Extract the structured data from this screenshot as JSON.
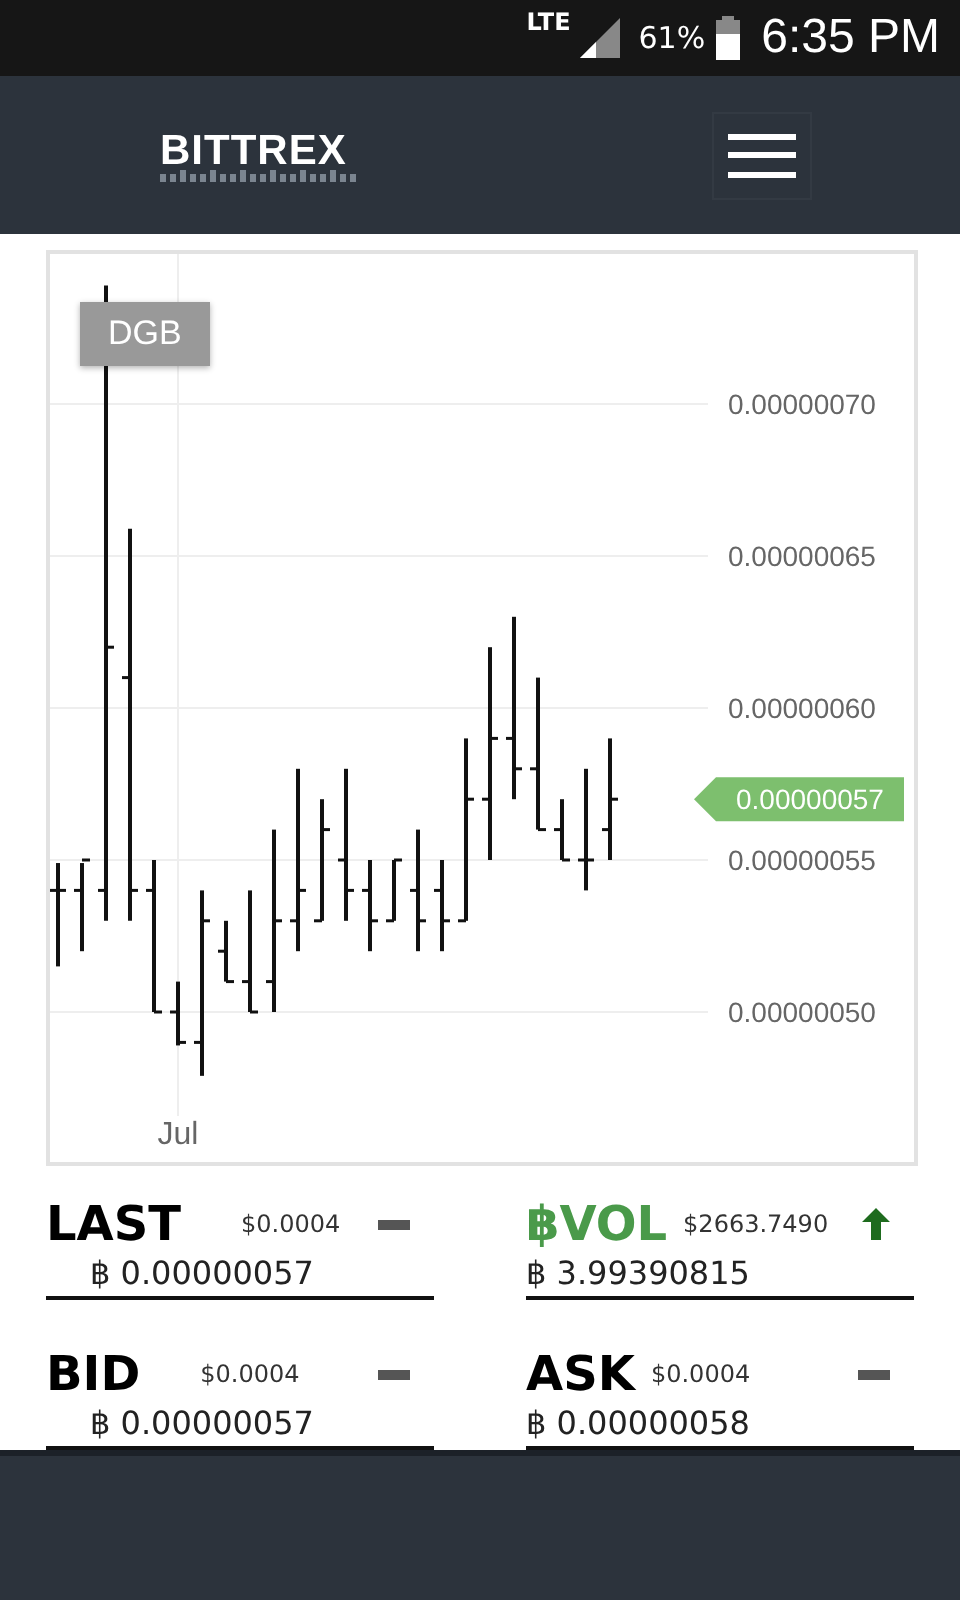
{
  "status_bar": {
    "network": "LTE",
    "battery": "61%",
    "time": "6:35 PM"
  },
  "header": {
    "logo": "BITTREX"
  },
  "chart": {
    "symbol": "DGB",
    "y_labels": [
      "0.00000070",
      "0.00000065",
      "0.00000060",
      "0.00000055",
      "0.00000050"
    ],
    "x_label": "Jul",
    "price_tag": "0.00000057"
  },
  "stats": [
    {
      "label": "LAST",
      "color": "#000000",
      "usd": "$0.0004",
      "kind": "flat",
      "btc": "฿ 0.00000057"
    },
    {
      "label": "฿VOL",
      "color": "#4a9a4a",
      "usd": "$2663.7490",
      "kind": "up",
      "btc": "฿ 3.99390815"
    },
    {
      "label": "BID",
      "color": "#000000",
      "usd": "$0.0004",
      "kind": "flat",
      "btc": "฿ 0.00000057"
    },
    {
      "label": "ASK",
      "color": "#000000",
      "usd": "$0.0004",
      "kind": "flat",
      "btc": "฿ 0.00000058"
    }
  ]
}
